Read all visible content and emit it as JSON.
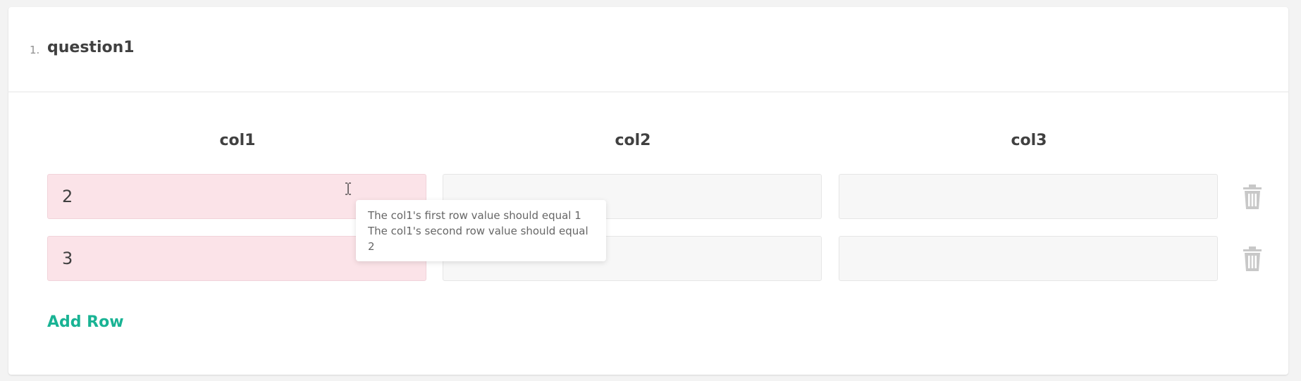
{
  "question": {
    "number": "1.",
    "title": "question1"
  },
  "columns": [
    "col1",
    "col2",
    "col3"
  ],
  "rows": [
    {
      "col1": "2",
      "col2": "",
      "col3": "",
      "col1_error": true
    },
    {
      "col1": "3",
      "col2": "",
      "col3": "",
      "col1_error": true
    }
  ],
  "add_row_label": "Add Row",
  "tooltip": {
    "line1": "The col1's first row value should equal 1",
    "line2": "The col1's second row value should equal 2"
  },
  "colors": {
    "accent": "#19b394",
    "error_bg": "#fbe3e8",
    "cell_bg": "#f7f7f7",
    "icon": "#c8c8c8"
  },
  "icons": {
    "remove_row": "trash-icon",
    "text_cursor": "text-cursor-icon"
  }
}
